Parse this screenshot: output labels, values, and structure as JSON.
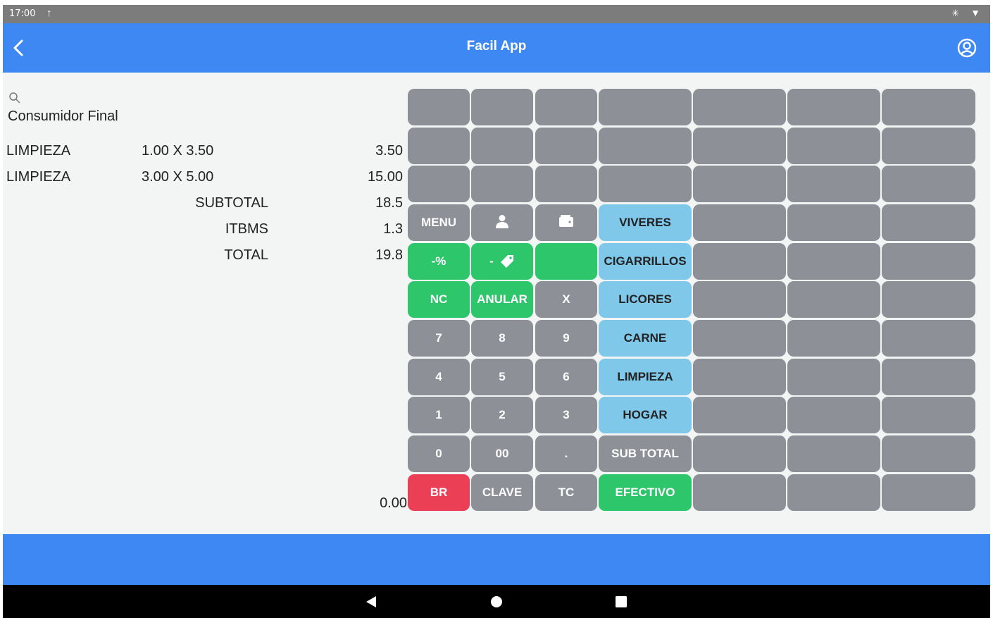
{
  "status_bar": {
    "time": "17:00",
    "upload_icon": "upload-icon",
    "bluetooth_icon": "bluetooth-icon",
    "wifi_icon": "wifi-icon"
  },
  "app_bar": {
    "title": "Facil App",
    "back_icon": "chevron-left-icon",
    "account_icon": "account-circle-icon",
    "color": "#3d88f2"
  },
  "customer": "Consumidor Final",
  "lines": [
    {
      "name": "LIMPIEZA",
      "qty": "1.00 X 3.50",
      "amount": "3.50"
    },
    {
      "name": "LIMPIEZA",
      "qty": "3.00 X 5.00",
      "amount": "15.00"
    }
  ],
  "summary": [
    {
      "label": "SUBTOTAL",
      "value": "18.5"
    },
    {
      "label": "ITBMS",
      "value": "1.3"
    },
    {
      "label": "TOTAL",
      "value": "19.8"
    }
  ],
  "entry_value": "0.00",
  "keypad": {
    "menu": "MENU",
    "percent": "-%",
    "discount": "-",
    "nc": "NC",
    "anular": "ANULAR",
    "x": "X",
    "d7": "7",
    "d8": "8",
    "d9": "9",
    "d4": "4",
    "d5": "5",
    "d6": "6",
    "d1": "1",
    "d2": "2",
    "d3": "3",
    "d0": "0",
    "d00": "00",
    "dot": ".",
    "br": "BR",
    "clave": "CLAVE",
    "tc": "TC"
  },
  "categories": {
    "viveres": "VIVERES",
    "cigarrillos": "CIGARRILLOS",
    "licores": "LICORES",
    "carne": "CARNE",
    "limpieza": "LIMPIEZA",
    "hogar": "HOGAR",
    "subtotal": "SUB TOTAL",
    "efectivo": "EFECTIVO"
  },
  "colors": {
    "key_gray": "#8e9097",
    "key_green": "#2ec66b",
    "key_red": "#eb3f55",
    "key_blue": "#7fc8ea"
  },
  "nav": {
    "back": "nav-back-icon",
    "home": "nav-home-icon",
    "recents": "nav-recents-icon"
  }
}
